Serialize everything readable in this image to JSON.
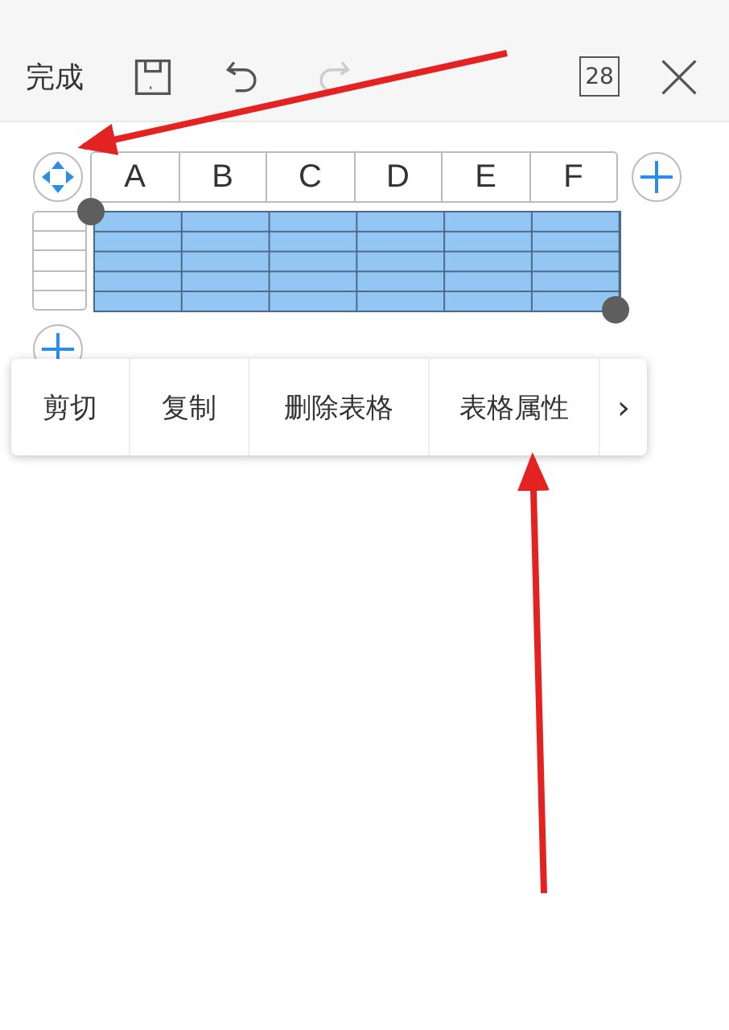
{
  "toolbar": {
    "done": "完成",
    "calendar_day": "28"
  },
  "table": {
    "columns": [
      "A",
      "B",
      "C",
      "D",
      "E",
      "F"
    ]
  },
  "context_menu": {
    "items": [
      "剪切",
      "复制",
      "删除表格",
      "表格属性"
    ],
    "more": "›"
  }
}
